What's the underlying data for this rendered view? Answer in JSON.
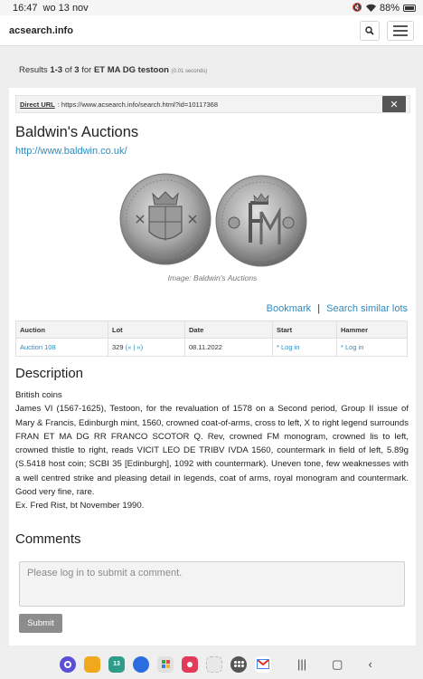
{
  "status": {
    "time": "16:47",
    "date": "wo 13 nov",
    "battery": "88%"
  },
  "nav": {
    "brand": "acsearch.info"
  },
  "results": {
    "prefix": "Results ",
    "range": "1-3",
    "of": " of ",
    "total": "3",
    "for": " for ",
    "query": "ET MA DG testoon",
    "timing": "(0.01 seconds)"
  },
  "url": {
    "label": "Direct URL",
    "value": ": https://www.acsearch.info/search.html?id=10117368",
    "close": "✕"
  },
  "auction_house": {
    "name": "Baldwin's Auctions",
    "url": "http://www.baldwin.co.uk/"
  },
  "image_caption": "Image: Baldwin's Auctions",
  "actions": {
    "bookmark": "Bookmark",
    "sep": "|",
    "similar": "Search similar lots"
  },
  "table": {
    "headers": [
      "Auction",
      "Lot",
      "Date",
      "Start",
      "Hammer"
    ],
    "row": {
      "auction": "Auction 108",
      "lot": "329",
      "lot_nav": "(« | »)",
      "date": "08.11.2022",
      "start": "* Log in",
      "hammer": "* Log in"
    }
  },
  "description": {
    "heading": "Description",
    "category": "British coins",
    "text": "James VI (1567-1625), Testoon, for the revaluation of 1578 on a Second period, Group II issue of Mary & Francis, Edinburgh mint, 1560, crowned coat-of-arms, cross to left, X to right legend surrounds FRAN ET MA DG RR FRANCO SCOTOR Q. Rev, crowned FM monogram, crowned lis to left, crowned thistle to right, reads VICIT LEO DE TRIBV IVDA 1560, countermark in field of left, 5.89g (S.5418 host coin; SCBI 35 [Edinburgh], 1092 with countermark). Uneven tone, few weaknesses with a well centred strike and pleasing detail in legends, coat of arms, royal monogram and countermark. Good very fine, rare.",
    "provenance": "Ex. Fred Rist, bt November 1990."
  },
  "comments": {
    "heading": "Comments",
    "placeholder": "Please log in to submit a comment.",
    "submit": "Submit"
  },
  "dock": {
    "calendar_day": "13",
    "apps": [
      "internet-app",
      "files-app",
      "calendar-app",
      "messages-app",
      "apps-folder",
      "screen-recorder-app",
      "more-apps",
      "gmail-app"
    ]
  }
}
